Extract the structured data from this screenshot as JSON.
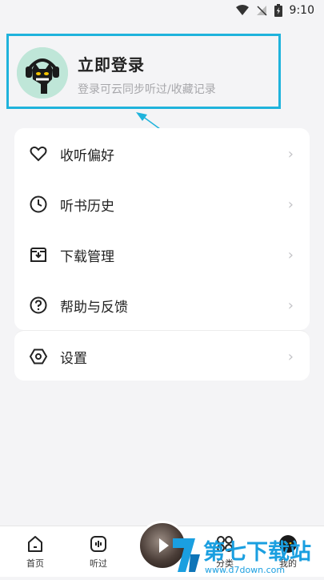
{
  "status_bar": {
    "time": "9:10"
  },
  "login": {
    "title": "立即登录",
    "subtitle": "登录可云同步听过/收藏记录"
  },
  "menu": {
    "items": [
      {
        "label": "收听偏好",
        "icon": "heart-icon"
      },
      {
        "label": "听书历史",
        "icon": "clock-icon"
      },
      {
        "label": "下载管理",
        "icon": "download-icon"
      },
      {
        "label": "帮助与反馈",
        "icon": "help-icon"
      }
    ],
    "settings": {
      "label": "设置",
      "icon": "settings-icon"
    },
    "chevron": "›"
  },
  "tabbar": {
    "home": "首页",
    "listened": "听过",
    "category": "分类",
    "mine": "我的"
  },
  "watermark": {
    "brand": "第七下载站",
    "url": "www.d7down.com"
  },
  "colors": {
    "accent": "#1fb3dc",
    "avatar_bg": "#bfe6d8"
  }
}
